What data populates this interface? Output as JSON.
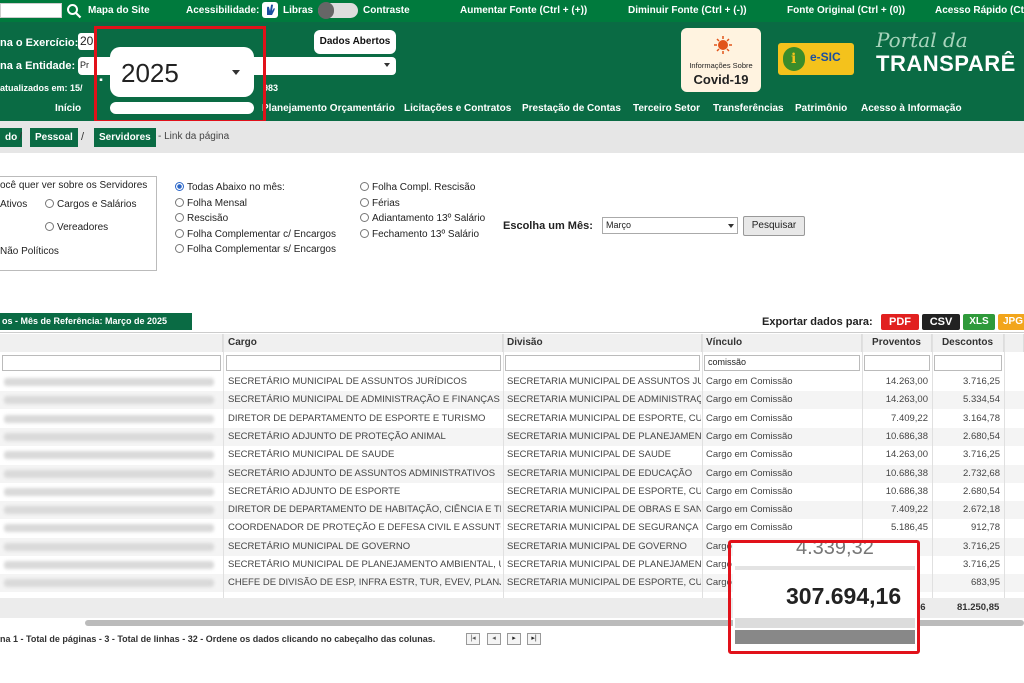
{
  "accessibility": {
    "mapa": "Mapa do Site",
    "acessibilidade": "Acessibilidade:",
    "libras": "Libras",
    "contraste": "Contraste",
    "aumentar": "Aumentar Fonte (Ctrl + (+))",
    "diminuir": "Diminuir Fonte (Ctrl + (-))",
    "original": "Fonte Original (Ctrl + (0))",
    "rapido": "Acesso Rápido (Ctrl"
  },
  "header": {
    "exercicio_label": "na o Exercício:",
    "exercicio_value": "20",
    "entidade_label": "na a Entidade:",
    "entidade_value": "Pr",
    "atualizados": "atualizados em: 15/",
    "atualizados_tail": "983",
    "dados_abertos": "Dados Abertos",
    "covid_small": "Informações Sobre",
    "covid_big": "Covid-19",
    "esic": "e-SIC",
    "portal_da": "Portal da",
    "transparencia": "TRANSPARÊ",
    "year_zoom": "2025"
  },
  "nav": [
    "Início",
    "Planejamento Orçamentário",
    "Licitações e Contratos",
    "Prestação de Contas",
    "Terceiro Setor",
    "Transferências",
    "Patrimônio",
    "Acesso à Informação"
  ],
  "breadcrumb": {
    "item1": "do",
    "item2": "Pessoal",
    "item3": "Servidores",
    "link": "- Link da página",
    "sep": "/"
  },
  "filters": {
    "question": "ocê quer ver sobre os Servidores",
    "ativos": "Ativos",
    "cargos": "Cargos e Salários",
    "vereadores": "Vereadores",
    "naopoliticos": "Não Políticos",
    "todas": "Todas Abaixo no mês:",
    "mensal": "Folha Mensal",
    "rescisao": "Rescisão",
    "comp_com": "Folha Complementar c/ Encargos",
    "comp_sem": "Folha Complementar s/ Encargos",
    "compl_resc": "Folha Compl. Rescisão",
    "ferias": "Férias",
    "adiant": "Adiantamento 13º Salário",
    "fech": "Fechamento 13º Salário",
    "mes_label": "Escolha um Mês:",
    "mes_value": "Março",
    "pesquisar": "Pesquisar"
  },
  "table": {
    "title": "os - Mês de Referência: Março de 2025",
    "exportar": "Exportar dados para:",
    "exports": [
      "PDF",
      "CSV",
      "XLS",
      "JPG"
    ],
    "headers": {
      "cargo": "Cargo",
      "divisao": "Divisão",
      "vinculo": "Vínculo",
      "proventos": "Proventos",
      "descontos": "Descontos"
    },
    "filter_vinculo": "comissão",
    "rows": [
      {
        "cargo": "SECRETÁRIO MUNICIPAL DE ASSUNTOS JURÍDICOS",
        "divisao": "SECRETARIA MUNICIPAL DE ASSUNTOS JURÍDICOS",
        "vinculo": "Cargo em Comissão",
        "proventos": "14.263,00",
        "descontos": "3.716,25"
      },
      {
        "cargo": "SECRETÁRIO MUNICIPAL DE ADMINISTRAÇÃO E FINANÇAS",
        "divisao": "SECRETARIA MUNICIPAL DE ADMINISTRAÇÃO E FINANÇAS",
        "vinculo": "Cargo em Comissão",
        "proventos": "14.263,00",
        "descontos": "5.334,54"
      },
      {
        "cargo": "DIRETOR DE DEPARTAMENTO DE ESPORTE E TURISMO",
        "divisao": "SECRETARIA MUNICIPAL DE ESPORTE, CULTURA",
        "vinculo": "Cargo em Comissão",
        "proventos": "7.409,22",
        "descontos": "3.164,78"
      },
      {
        "cargo": "SECRETÁRIO ADJUNTO DE PROTEÇÃO ANIMAL",
        "divisao": "SECRETARIA MUNICIPAL DE PLANEJAMENTO AMBIENTAL",
        "vinculo": "Cargo em Comissão",
        "proventos": "10.686,38",
        "descontos": "2.680,54"
      },
      {
        "cargo": "SECRETÁRIO MUNICIPAL DE SAUDE",
        "divisao": "SECRETARIA MUNICIPAL DE SAUDE",
        "vinculo": "Cargo em Comissão",
        "proventos": "14.263,00",
        "descontos": "3.716,25"
      },
      {
        "cargo": "SECRETÁRIO ADJUNTO DE ASSUNTOS ADMINISTRATIVOS",
        "divisao": "SECRETARIA MUNICIPAL DE EDUCAÇÃO",
        "vinculo": "Cargo em Comissão",
        "proventos": "10.686,38",
        "descontos": "2.732,68"
      },
      {
        "cargo": "SECRETÁRIO ADJUNTO DE ESPORTE",
        "divisao": "SECRETARIA MUNICIPAL DE ESPORTE, CULTURA",
        "vinculo": "Cargo em Comissão",
        "proventos": "10.686,38",
        "descontos": "2.680,54"
      },
      {
        "cargo": "DIRETOR DE DEPARTAMENTO DE HABITAÇÃO, CIÊNCIA E TECNOLOGIA",
        "divisao": "SECRETARIA MUNICIPAL DE OBRAS E SANEAMENTO",
        "vinculo": "Cargo em Comissão",
        "proventos": "7.409,22",
        "descontos": "2.672,18"
      },
      {
        "cargo": "COORDENADOR DE PROTEÇÃO E DEFESA CIVIL E ASSUNTOS CO",
        "divisao": "SECRETARIA MUNICIPAL DE SEGURANÇA PUBLICA",
        "vinculo": "Cargo em Comissão",
        "proventos": "5.186,45",
        "descontos": "912,78"
      },
      {
        "cargo": "SECRETÁRIO MUNICIPAL DE GOVERNO",
        "divisao": "SECRETARIA MUNICIPAL DE GOVERNO",
        "vinculo": "Cargo",
        "proventos": "",
        "descontos": "3.716,25"
      },
      {
        "cargo": "SECRETÁRIO MUNICIPAL DE PLANEJAMENTO AMBIENTAL, URBANO",
        "divisao": "SECRETARIA MUNICIPAL DE PLANEJAMENTO AMBIENTAL",
        "vinculo": "Cargo",
        "proventos": "",
        "descontos": "3.716,25"
      },
      {
        "cargo": "CHEFE DE DIVISÃO DE ESP, INFRA ESTR, TUR, EVEV, PLANJ E PESQ",
        "divisao": "SECRETARIA MUNICIPAL DE ESPORTE, CULTURA",
        "vinculo": "Cargo",
        "proventos": "",
        "descontos": "683,95"
      }
    ],
    "total_prov_tail": "16",
    "total_descontos": "81.250,85",
    "paging": "na 1 - Total de páginas - 3 - Total de linhas - 32 - Ordene os dados clicando no cabeçalho das colunas."
  },
  "zoom": {
    "prev_value": "4.339,32",
    "total": "307.694,16"
  },
  "colors": {
    "green": "#0a6b44",
    "highlight": "#e1111a"
  }
}
